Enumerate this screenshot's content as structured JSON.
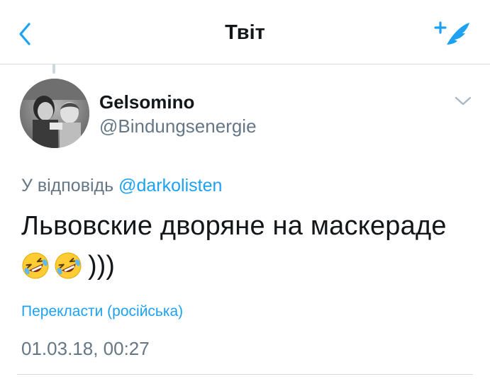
{
  "nav": {
    "title": "Твіт",
    "back_icon": "chevron-left-icon",
    "compose_icon": "compose-feather-icon",
    "accent_color": "#1da1f2"
  },
  "tweet": {
    "author": {
      "display_name": "Gelsomino",
      "handle": "@Bindungsenergie",
      "avatar_icon": "avatar-photo"
    },
    "reply_to": {
      "prefix": "У відповідь",
      "mention": "@darkolisten"
    },
    "text": "Львовские дворяне на маскераде",
    "emoji_line": {
      "emojis": [
        "rolling-on-floor-laughing-emoji",
        "rolling-on-floor-laughing-emoji"
      ],
      "suffix": ")))"
    },
    "translate_label": "Перекласти (російська)",
    "timestamp": "01.03.18, 00:27",
    "menu_icon": "chevron-down-icon"
  },
  "colors": {
    "primary_text": "#14171a",
    "secondary_text": "#657786",
    "link": "#1da1f2",
    "divider": "#d6dbe0"
  }
}
